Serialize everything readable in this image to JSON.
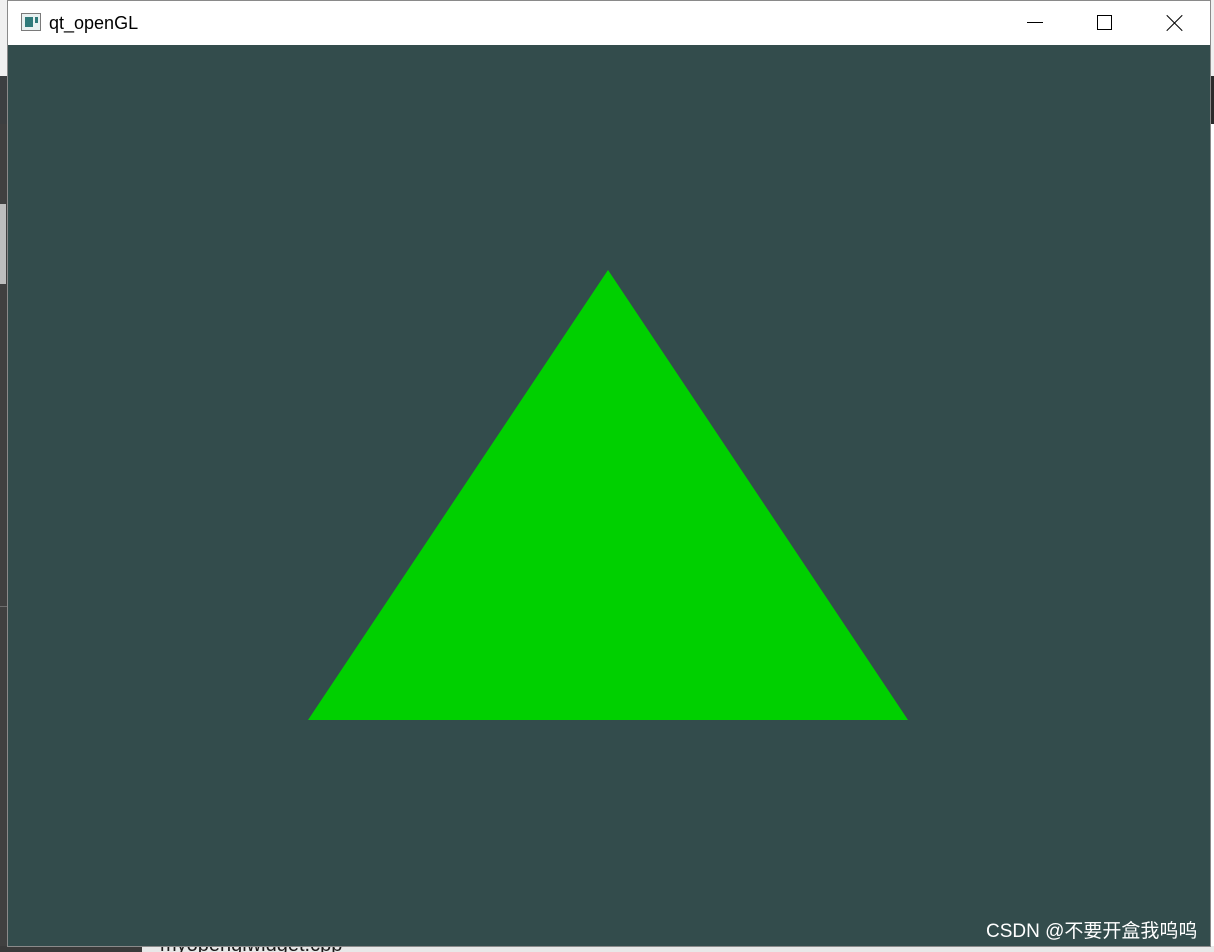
{
  "window": {
    "title": "qt_openGL",
    "icon": "app-window-icon",
    "controls": {
      "minimize": "minimize-icon",
      "maximize": "maximize-icon",
      "close": "close-icon"
    }
  },
  "canvas": {
    "clear_color": "#334c4c",
    "triangle_color": "#00d000"
  },
  "background": {
    "file_fragment": "myopenglwidget.cpp"
  },
  "watermark": {
    "text": "CSDN @不要开盒我呜呜"
  }
}
